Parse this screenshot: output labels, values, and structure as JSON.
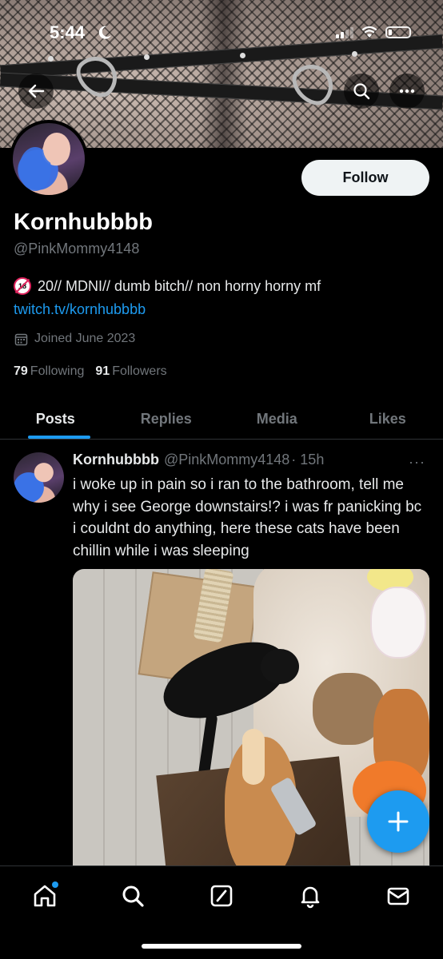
{
  "status_bar": {
    "time": "5:44"
  },
  "profile": {
    "display_name": "Kornhubbbb",
    "handle": "@PinkMommy4148",
    "bio": "20// MDNI// dumb bitch// non horny horny mf",
    "bio_badge": "18",
    "link": "twitch.tv/kornhubbbb",
    "joined": "Joined June 2023",
    "following_count": "79",
    "following_label": "Following",
    "followers_count": "91",
    "followers_label": "Followers",
    "follow_label": "Follow"
  },
  "tabs": [
    {
      "label": "Posts",
      "active": true
    },
    {
      "label": "Replies",
      "active": false
    },
    {
      "label": "Media",
      "active": false
    },
    {
      "label": "Likes",
      "active": false
    }
  ],
  "post": {
    "name": "Kornhubbbb",
    "handle": "@PinkMommy4148",
    "time": "· 15h",
    "more": "···",
    "text": "i woke up in pain so i ran to the bathroom, tell me why i see George downstairs!? i was fr panicking bc i couldnt do anything, here these cats have been chillin while i was sleeping"
  },
  "icons": {
    "back": "arrow-left-icon",
    "search": "search-icon",
    "more": "more-icon",
    "compose": "plus-icon",
    "nav": [
      "home-icon",
      "search-icon",
      "grok-icon",
      "notifications-icon",
      "messages-icon"
    ]
  },
  "colors": {
    "accent": "#1d9bf0",
    "background": "#000000",
    "secondary_text": "#71767b"
  }
}
